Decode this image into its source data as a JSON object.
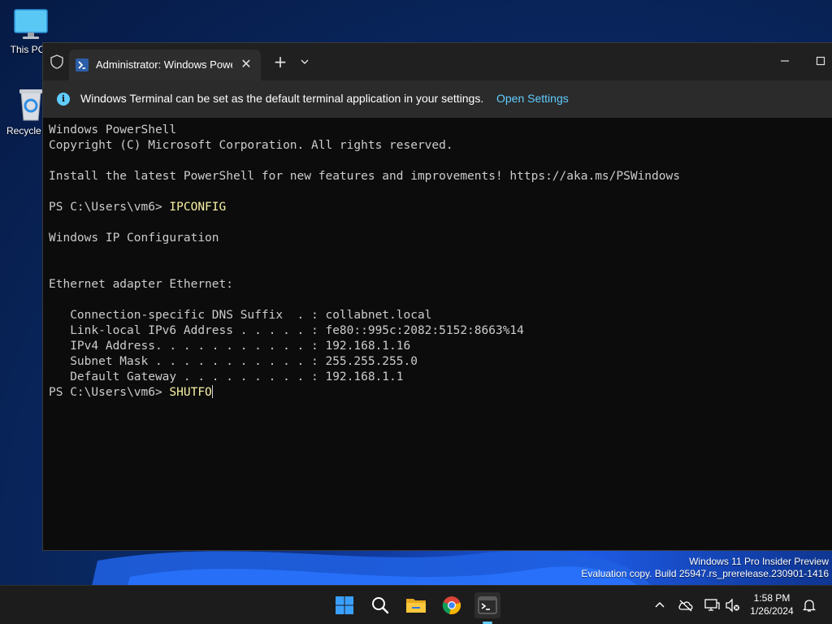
{
  "desktop": {
    "icons": [
      {
        "label": "This PC"
      },
      {
        "label": "Recycle Bin"
      }
    ],
    "watermark": {
      "line1": "Windows 11 Pro Insider Preview",
      "line2": "Evaluation copy. Build 25947.rs_prerelease.230901-1416"
    }
  },
  "terminal": {
    "tab_title": "Administrator: Windows PowerShell",
    "infobar": {
      "message": "Windows Terminal can be set as the default terminal application in your settings.",
      "link": "Open Settings"
    },
    "lines": [
      {
        "text": "Windows PowerShell"
      },
      {
        "text": "Copyright (C) Microsoft Corporation. All rights reserved."
      },
      {
        "text": ""
      },
      {
        "text": "Install the latest PowerShell for new features and improvements! https://aka.ms/PSWindows"
      },
      {
        "text": ""
      },
      {
        "prompt": "PS C:\\Users\\vm6> ",
        "cmd": "IPCONFIG"
      },
      {
        "text": ""
      },
      {
        "text": "Windows IP Configuration"
      },
      {
        "text": ""
      },
      {
        "text": ""
      },
      {
        "text": "Ethernet adapter Ethernet:"
      },
      {
        "text": ""
      },
      {
        "text": "   Connection-specific DNS Suffix  . : collabnet.local"
      },
      {
        "text": "   Link-local IPv6 Address . . . . . : fe80::995c:2082:5152:8663%14"
      },
      {
        "text": "   IPv4 Address. . . . . . . . . . . : 192.168.1.16"
      },
      {
        "text": "   Subnet Mask . . . . . . . . . . . : 255.255.255.0"
      },
      {
        "text": "   Default Gateway . . . . . . . . . : 192.168.1.1"
      },
      {
        "prompt": "PS C:\\Users\\vm6> ",
        "cmd": "SHUTFO"
      }
    ],
    "colors": {
      "background": "#0c0c0c",
      "text": "#cccccc",
      "command": "#f9f1a5",
      "accent": "#60cdff"
    }
  },
  "taskbar": {
    "apps": [
      "start-icon",
      "search-icon",
      "file-explorer-icon",
      "chrome-icon",
      "terminal-icon"
    ],
    "tray": [
      "chevron-up-icon",
      "onedrive-icon",
      "network-icon",
      "volume-icon",
      "notification-bell-icon"
    ],
    "clock": {
      "time": "1:58 PM",
      "date": "1/26/2024"
    }
  }
}
